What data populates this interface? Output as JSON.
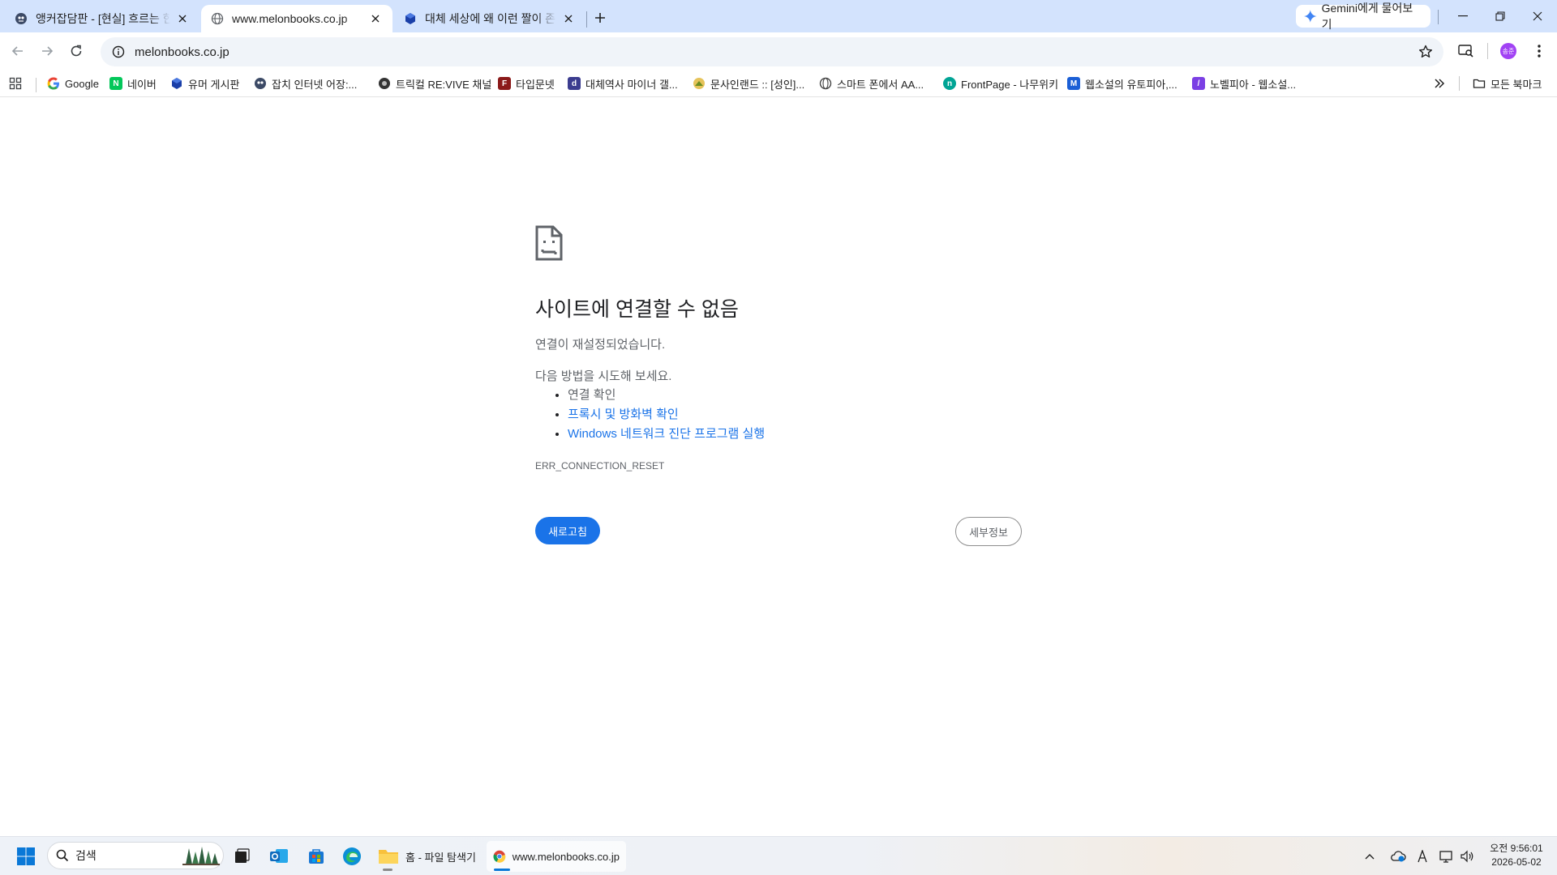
{
  "tabs": [
    {
      "title": "앵커잡담판 - [현실] 흐르는 한강",
      "active": false
    },
    {
      "title": "www.melonbooks.co.jp",
      "active": true
    },
    {
      "title": "대체 세상에 왜 이런 짤이 존재",
      "active": false
    }
  ],
  "gemini": {
    "label": "Gemini에게 물어보기"
  },
  "toolbar": {
    "url": "melonbooks.co.jp",
    "avatar_text": "송준"
  },
  "bookmarks": [
    {
      "label": "Google"
    },
    {
      "label": "네이버"
    },
    {
      "label": "유머 게시판"
    },
    {
      "label": "잡치 인터넷 어장:..."
    },
    {
      "label": "트릭컬 RE:VIVE 채널"
    },
    {
      "label": "타입문넷"
    },
    {
      "label": "대체역사 마이너 갤..."
    },
    {
      "label": "문사인랜드 :: [성인]..."
    },
    {
      "label": "스마트 폰에서 AA..."
    },
    {
      "label": "FrontPage - 나무위키"
    },
    {
      "label": "웹소설의 유토피아,..."
    },
    {
      "label": "노벨피아 - 웹소설..."
    }
  ],
  "all_bookmarks": "모든 북마크",
  "error": {
    "title": "사이트에 연결할 수 없음",
    "description": "연결이 재설정되었습니다.",
    "try_intro": "다음 방법을 시도해 보세요.",
    "suggestions": [
      {
        "text": "연결 확인",
        "link": false
      },
      {
        "text": "프록시 및 방화벽 확인",
        "link": true
      },
      {
        "text": "Windows 네트워크 진단 프로그램 실행",
        "link": true
      }
    ],
    "code": "ERR_CONNECTION_RESET",
    "reload_button": "새로고침",
    "details_button": "세부정보"
  },
  "taskbar": {
    "search_label": "검색",
    "explorer_label": "홈 - 파일 탐색기",
    "chrome_label": "www.melonbooks.co.jp",
    "time": "오전 9:56:01",
    "date": "2026-05-02"
  },
  "colors": {
    "accent": "#1a73e8",
    "tabstrip": "#d3e3fd",
    "omnibox": "#f0f4f9"
  }
}
